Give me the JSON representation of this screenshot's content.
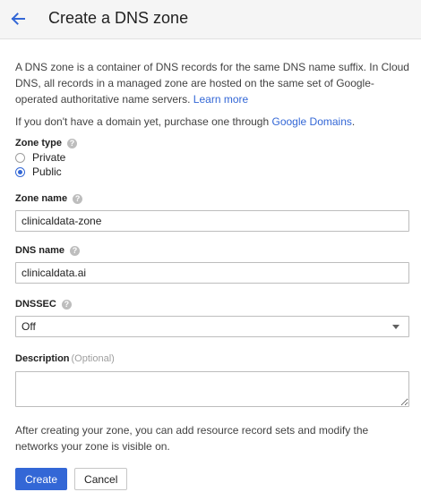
{
  "header": {
    "title": "Create a DNS zone",
    "back_icon": "arrow-left-icon"
  },
  "intro": {
    "text": "A DNS zone is a container of DNS records for the same DNS name suffix. In Cloud DNS, all records in a managed zone are hosted on the same set of Google-operated authoritative name servers.",
    "learn_more": "Learn more",
    "domain_prefix": "If you don't have a domain yet, purchase one through",
    "domain_link": "Google Domains",
    "domain_suffix": "."
  },
  "zone_type": {
    "label": "Zone type",
    "options": [
      {
        "label": "Private",
        "checked": false
      },
      {
        "label": "Public",
        "checked": true
      }
    ]
  },
  "zone_name": {
    "label": "Zone name",
    "value": "clinicaldata-zone"
  },
  "dns_name": {
    "label": "DNS name",
    "value": "clinicaldata.ai"
  },
  "dnssec": {
    "label": "DNSSEC",
    "selected": "Off"
  },
  "description": {
    "label": "Description",
    "optional": "(Optional)",
    "value": ""
  },
  "footer": {
    "text": "After creating your zone, you can add resource record sets and modify the networks your zone is visible on.",
    "create_label": "Create",
    "cancel_label": "Cancel"
  },
  "colors": {
    "accent": "#3367d6",
    "header_bg": "#f5f5f5"
  }
}
